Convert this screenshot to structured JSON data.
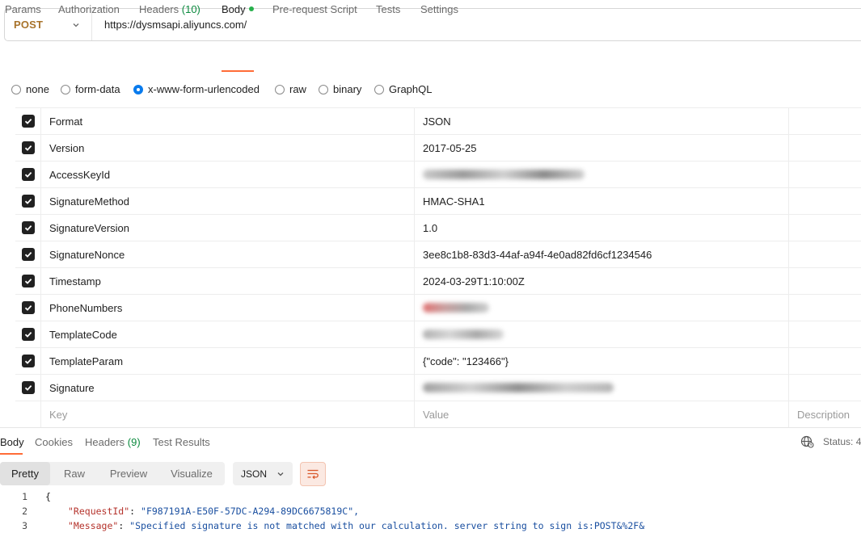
{
  "request": {
    "method": "POST",
    "url": "https://dysmsapi.aliyuncs.com/"
  },
  "request_tabs": [
    {
      "label": "Params"
    },
    {
      "label": "Authorization"
    },
    {
      "label": "Headers",
      "count": "(10)"
    },
    {
      "label": "Body"
    },
    {
      "label": "Pre-request Script"
    },
    {
      "label": "Tests"
    },
    {
      "label": "Settings"
    }
  ],
  "body_types": [
    {
      "label": "none",
      "checked": false
    },
    {
      "label": "form-data",
      "checked": false
    },
    {
      "label": "x-www-form-urlencoded",
      "checked": true
    },
    {
      "label": "raw",
      "checked": false
    },
    {
      "label": "binary",
      "checked": false
    },
    {
      "label": "GraphQL",
      "checked": false
    }
  ],
  "params": [
    {
      "key": "Format",
      "value": "JSON"
    },
    {
      "key": "Version",
      "value": "2017-05-25"
    },
    {
      "key": "AccessKeyId",
      "value": ""
    },
    {
      "key": "SignatureMethod",
      "value": "HMAC-SHA1"
    },
    {
      "key": "SignatureVersion",
      "value": "1.0"
    },
    {
      "key": "SignatureNonce",
      "value": "3ee8c1b8-83d3-44af-a94f-4e0ad82fd6cf1234546"
    },
    {
      "key": "Timestamp",
      "value": "2024-03-29T1:10:00Z"
    },
    {
      "key": "PhoneNumbers",
      "value": ""
    },
    {
      "key": "TemplateCode",
      "value": ""
    },
    {
      "key": "TemplateParam",
      "value": "{\"code\": \"123466\"}"
    },
    {
      "key": "Signature",
      "value": ""
    }
  ],
  "table_header": {
    "key": "Key",
    "value": "Value",
    "description": "Description"
  },
  "response_tabs": [
    {
      "label": "Body"
    },
    {
      "label": "Cookies"
    },
    {
      "label": "Headers",
      "count": "(9)"
    },
    {
      "label": "Test Results"
    }
  ],
  "status_label": "Status: 4",
  "view_modes": [
    "Pretty",
    "Raw",
    "Preview",
    "Visualize"
  ],
  "format": "JSON",
  "code_lines": [
    {
      "num": "1",
      "text": "{"
    },
    {
      "num": "2",
      "key": "\"RequestId\"",
      "value": "\"F987191A-E50F-57DC-A294-89DC6675819C\","
    },
    {
      "num": "3",
      "key": "\"Message\"",
      "value": "\"Specified signature is not matched with our calculation. server string to sign is:POST&%2F&"
    }
  ]
}
